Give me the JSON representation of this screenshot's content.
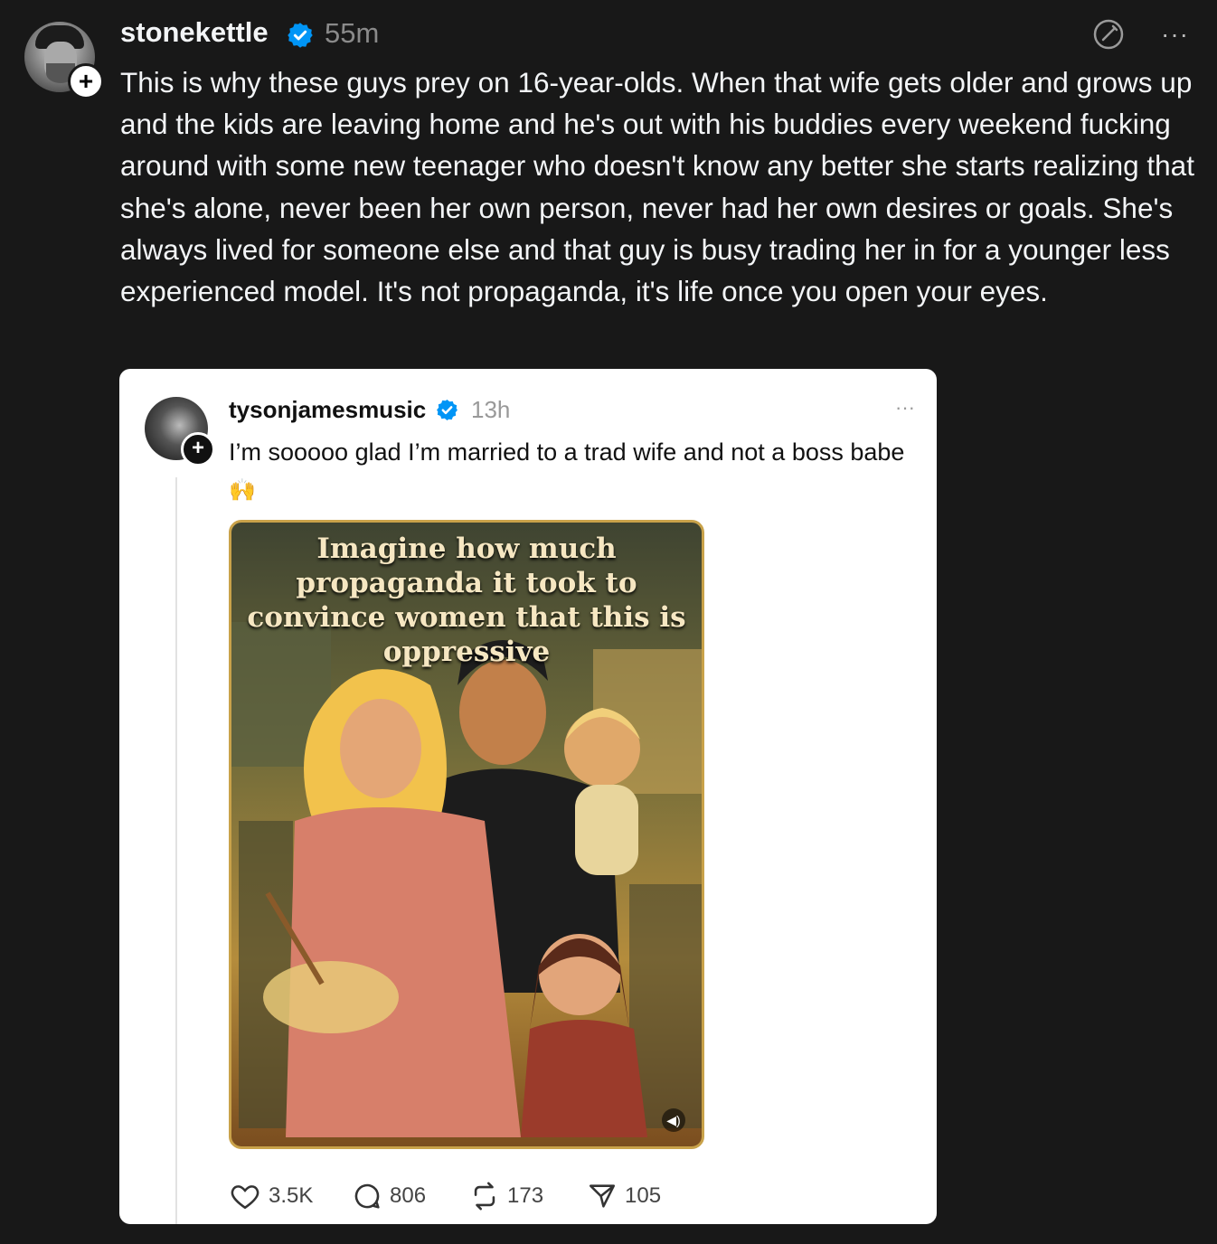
{
  "post": {
    "username": "stonekettle",
    "time": "55m",
    "text": "This is why these guys prey on 16-year-olds. When that wife gets older and grows up and the kids are leaving home and he's out with his buddies every weekend fucking around with some new teenager who doesn't know any better she starts realizing that she's alone, never been her own person, never had her own desires or goals. She's always lived for someone else and that guy is busy trading her in for a younger less experienced model. It's not propaganda, it's life once you open your eyes.",
    "more_label": "···"
  },
  "quoted": {
    "username": "tysonjamesmusic",
    "time": "13h",
    "text": "I’m sooooo glad I’m married to a trad wife and not a boss babe",
    "emoji": "🙌",
    "more_label": "···",
    "image_caption": "Imagine how much propaganda it took to convince women that this is oppressive",
    "actions": {
      "likes": "3.5K",
      "replies": "806",
      "reposts": "173",
      "shares": "105"
    }
  },
  "colors": {
    "background": "#181818",
    "verified": "#0095f6",
    "card": "#ffffff"
  }
}
